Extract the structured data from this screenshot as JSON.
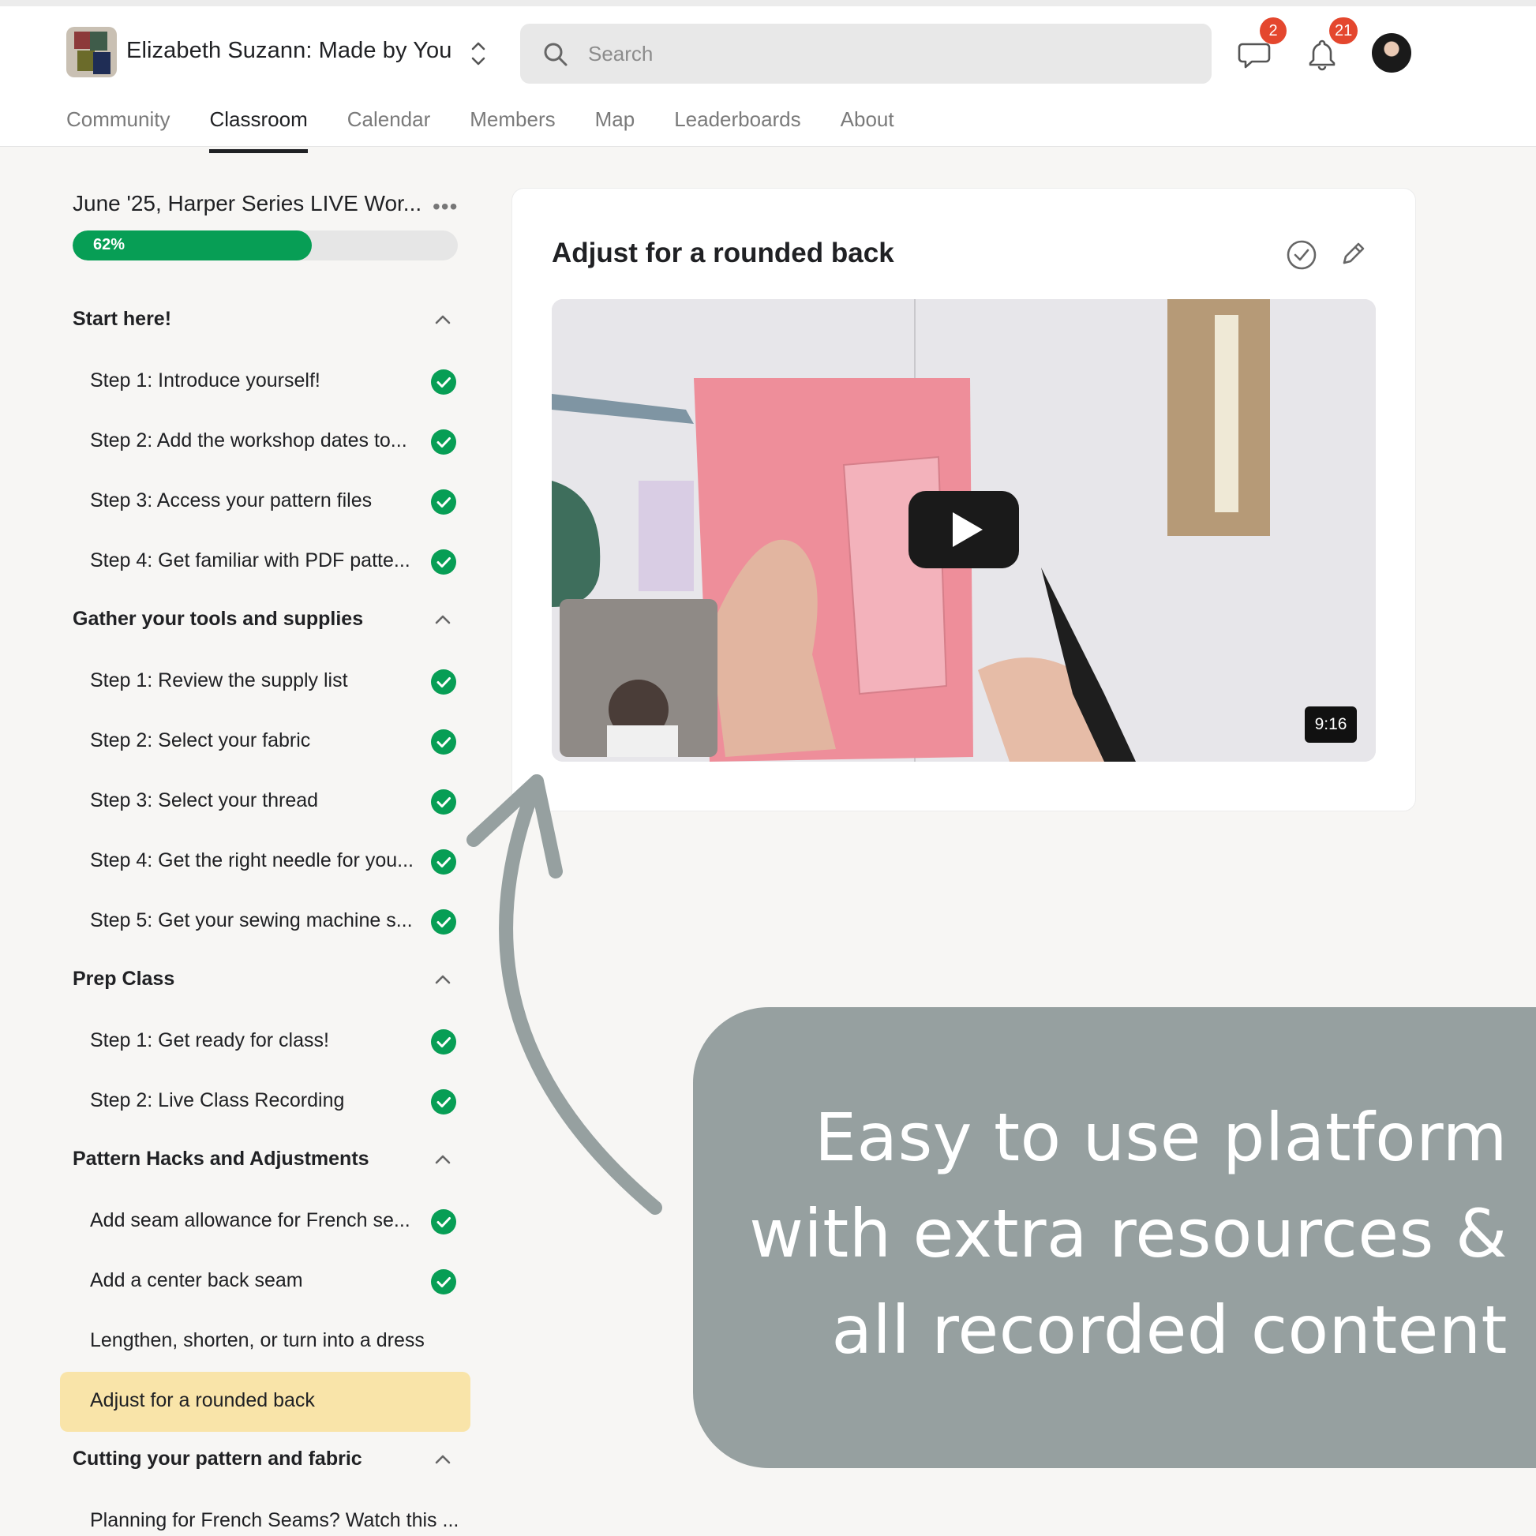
{
  "header": {
    "brand_name": "Elizabeth Suzann: Made by You",
    "search_placeholder": "Search",
    "chat_badge": "2",
    "notifications_badge": "21"
  },
  "tabs": [
    "Community",
    "Classroom",
    "Calendar",
    "Members",
    "Map",
    "Leaderboards",
    "About"
  ],
  "active_tab": "Classroom",
  "course": {
    "title": "June '25, Harper Series LIVE Wor...",
    "progress_label": "62%",
    "progress_fraction": 0.62
  },
  "sections": [
    {
      "title": "Start here!",
      "lessons": [
        {
          "label": "Step 1: Introduce yourself!",
          "done": true
        },
        {
          "label": "Step 2: Add the workshop dates to...",
          "done": true
        },
        {
          "label": "Step 3: Access your pattern files",
          "done": true
        },
        {
          "label": "Step 4: Get familiar with PDF patte...",
          "done": true
        }
      ]
    },
    {
      "title": "Gather your tools and supplies",
      "lessons": [
        {
          "label": "Step 1: Review the supply list",
          "done": true
        },
        {
          "label": "Step 2: Select your fabric",
          "done": true
        },
        {
          "label": "Step 3: Select your thread",
          "done": true
        },
        {
          "label": "Step 4: Get the right needle for you...",
          "done": true
        },
        {
          "label": "Step 5: Get your sewing machine s...",
          "done": true
        }
      ]
    },
    {
      "title": "Prep Class",
      "lessons": [
        {
          "label": "Step 1: Get ready for class!",
          "done": true
        },
        {
          "label": "Step 2: Live Class Recording",
          "done": true
        }
      ]
    },
    {
      "title": "Pattern Hacks and Adjustments",
      "lessons": [
        {
          "label": "Add seam allowance for French se...",
          "done": true
        },
        {
          "label": "Add a center back seam",
          "done": true
        },
        {
          "label": "Lengthen, shorten, or turn into a dress",
          "done": false
        },
        {
          "label": "Adjust for a rounded back",
          "done": false,
          "active": true
        }
      ]
    },
    {
      "title": "Cutting your pattern and fabric",
      "lessons": [
        {
          "label": "Planning for French Seams? Watch this ...",
          "done": false
        }
      ]
    }
  ],
  "lesson": {
    "title": "Adjust for a rounded back",
    "video_duration": "9:16"
  },
  "callout": {
    "lines": [
      "Easy to use platform",
      "with extra resources &",
      "all recorded content"
    ]
  },
  "colors": {
    "accent_green": "#079e55",
    "active_lesson": "#f9e4a9",
    "badge_red": "#e4472e",
    "callout_bg": "#96a0a0"
  }
}
